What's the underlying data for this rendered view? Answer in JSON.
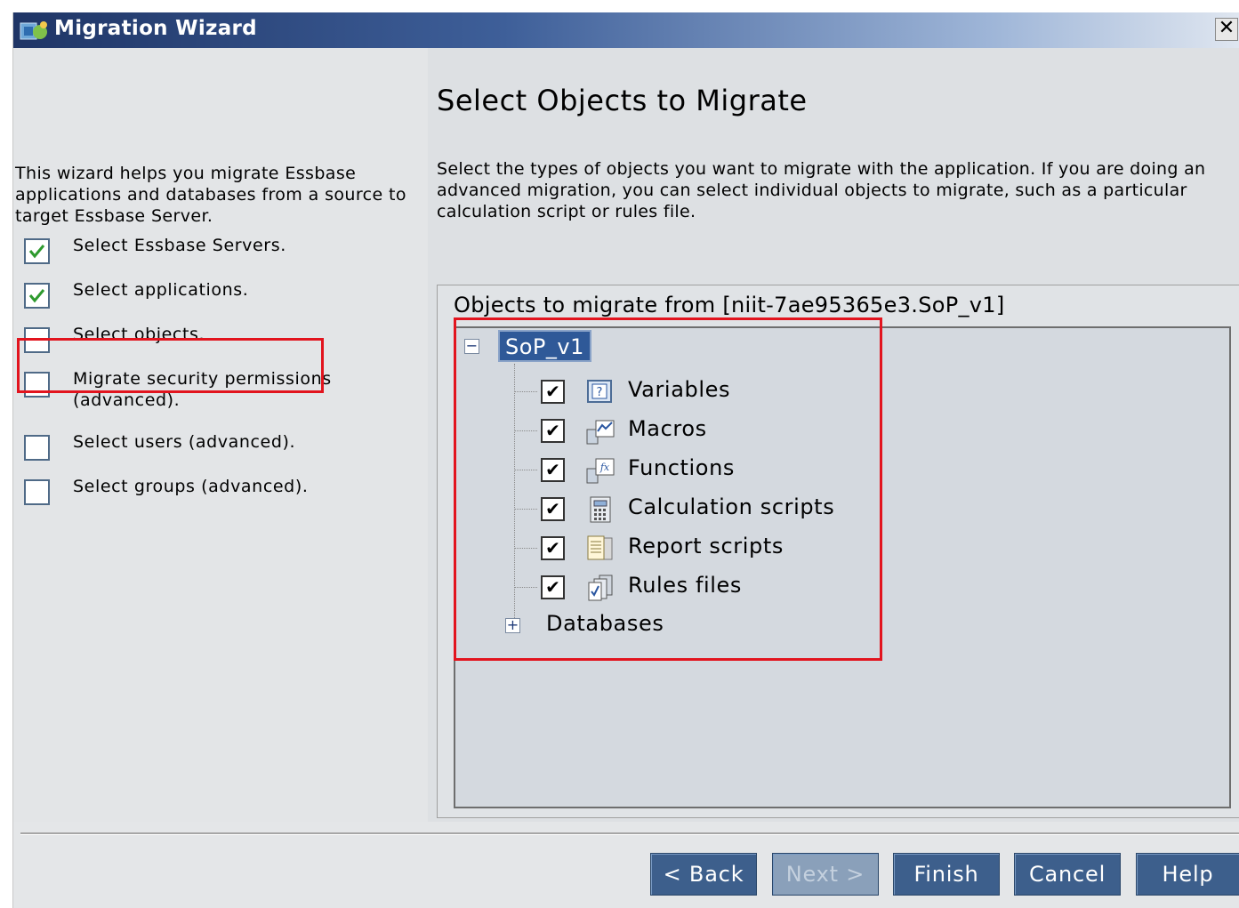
{
  "window": {
    "title": "Migration Wizard",
    "close_label": "✕"
  },
  "left_panel": {
    "intro": "This wizard helps you migrate Essbase applications and databases from a source to target Essbase Server.",
    "steps": [
      {
        "label": "Select Essbase Servers.",
        "checked": true
      },
      {
        "label": "Select applications.",
        "checked": true
      },
      {
        "label": "Select objects.",
        "checked": false
      },
      {
        "label": "Migrate security permissions (advanced).",
        "checked": false
      },
      {
        "label": "Select users (advanced).",
        "checked": false
      },
      {
        "label": "Select groups (advanced).",
        "checked": false
      }
    ]
  },
  "main": {
    "heading": "Select Objects to Migrate",
    "description": "Select the types of objects you want to migrate with the application. If you are doing an advanced migration, you can select individual objects to migrate, such as a particular calculation script or rules file.",
    "panel_title": "Objects to migrate from [niit-7ae95365e3.SoP_v1]",
    "tree": {
      "root": {
        "label": "SoP_v1",
        "expander": "−"
      },
      "items": [
        {
          "label": "Variables",
          "checked": true,
          "icon": "variables-icon"
        },
        {
          "label": "Macros",
          "checked": true,
          "icon": "macros-icon"
        },
        {
          "label": "Functions",
          "checked": true,
          "icon": "functions-icon"
        },
        {
          "label": "Calculation scripts",
          "checked": true,
          "icon": "calc-scripts-icon"
        },
        {
          "label": "Report scripts",
          "checked": true,
          "icon": "report-scripts-icon"
        },
        {
          "label": "Rules files",
          "checked": true,
          "icon": "rules-files-icon"
        }
      ],
      "databases": {
        "label": "Databases",
        "expander": "+"
      }
    }
  },
  "buttons": {
    "back": "< Back",
    "next": "Next >",
    "finish": "Finish",
    "cancel": "Cancel",
    "help": "Help"
  },
  "colors": {
    "highlight": "#e2141e",
    "button": "#3d5f8c",
    "selection": "#2f5998",
    "check": "#2e9a2e"
  }
}
